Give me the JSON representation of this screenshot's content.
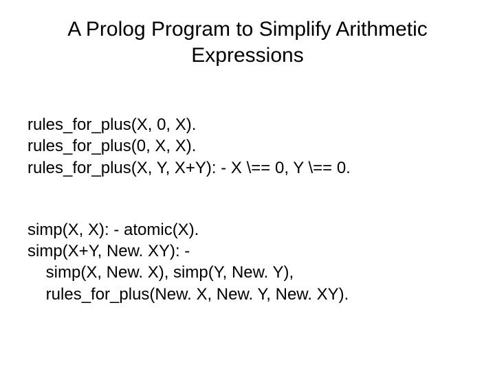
{
  "title": "A Prolog Program to Simplify Arithmetic Expressions",
  "code": {
    "line1": "rules_for_plus(X, 0, X).",
    "line2": "rules_for_plus(0, X, X).",
    "line3": "rules_for_plus(X, Y, X+Y): - X \\== 0, Y \\== 0.",
    "line4": "simp(X, X): - atomic(X).",
    "line5": "simp(X+Y, New. XY): -",
    "line6": "    simp(X, New. X), simp(Y, New. Y),",
    "line7": "    rules_for_plus(New. X, New. Y, New. XY)."
  }
}
